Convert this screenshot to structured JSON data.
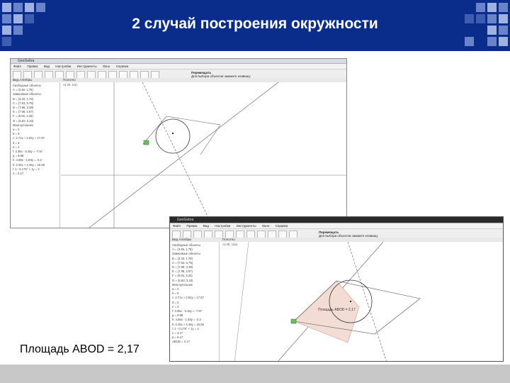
{
  "slide": {
    "title": "2 случай построения окружности",
    "caption": "Площадь ABOD = 2,17",
    "colors": {
      "banner": "#0a2d8c",
      "banner_squares": "#6b83c8",
      "footer": "#c8c8c8",
      "polygon_fill": "#f3dcd4",
      "polygon_stroke": "#c9a090",
      "point_green": "#6fbf5f"
    }
  },
  "window1": {
    "title": "GeoGebra",
    "menu": [
      "Файл",
      "Правка",
      "Вид",
      "Настройки",
      "Инструменты",
      "Окно",
      "Справка"
    ],
    "tool_hint": [
      "Перемещать",
      "Для выбора объектов зажмите клавишу"
    ],
    "algebra_header": "Вид Алгебры",
    "graphics_header": "Полотно",
    "coordinate_readout": "A(-20, 5,5)",
    "algebra_items": [
      "Свободные объекты",
      "A = (3.48, 1.78)",
      "Зависимые объекты",
      "B = (3.33, 1.78)",
      "C = (7.53, 5.75)",
      "D = (7.98, 3.38)",
      "E = (7.98, 3.97)",
      "F = (5.03, 3.33)",
      "O = (5.83, 3.33)",
      "Многоугольник",
      "a = 2",
      "b = 5",
      "c: 2.71x + 2.82y = 17.87",
      "d = 2",
      "e = 4",
      "f: 3.35x - 5.15y = -7.97",
      "g = 9.88",
      "h: 4.86x - 1.93y = -2.2",
      "k: 3.46x + 4.46y = 15.06",
      "l: 1 - 0.175° + 1y = 2",
      "n = 4.17"
    ]
  },
  "window2": {
    "title": "GeoGebra",
    "menu": [
      "Файл",
      "Правка",
      "Вид",
      "Настройки",
      "Инструменты",
      "Окно",
      "Справка"
    ],
    "tool_hint": [
      "Перемещать",
      "Для выбора объектов зажмите клавишу"
    ],
    "algebra_header": "Вид Алгебры",
    "graphics_header": "Полотно",
    "coordinate_readout": "A(-20, 12а)",
    "region_label": "Площадь ABOD = 2,17",
    "algebra_items": [
      "Свободные объекты",
      "A = (3.48, 1.78)",
      "Зависимые объекты",
      "B = (3.33, 1.78)",
      "C = (7.53, 5.75)",
      "D = (7.98, 3.38)",
      "E = (7.98, 3.97)",
      "F = (5.03, 3.33)",
      "O = (5.83, 3.33)",
      "Многоугольник",
      "a = 2",
      "b = 5",
      "c: 2.71x + 2.82y = 17.87",
      "d = 2",
      "e = 4",
      "f: 3.35x - 5.15y = -7.97",
      "g = 9.88",
      "h: 4.86x - 1.93y = -2.2",
      "k: 3.46x + 4.46y = 15.06",
      "l: 1 - 0.175° + 1y = 2",
      "n = 4.17",
      "p = 5.17",
      "ABOD = 2.17"
    ]
  }
}
